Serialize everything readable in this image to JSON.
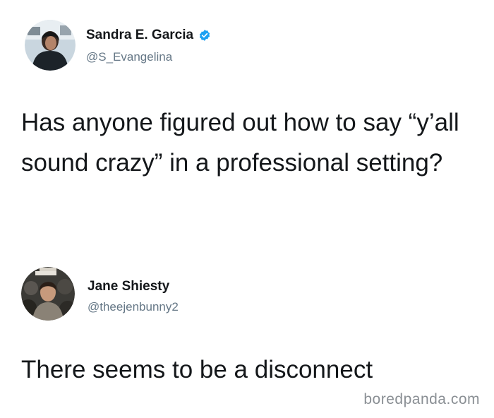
{
  "tweets": [
    {
      "display_name": "Sandra E. Garcia",
      "handle": "@S_Evangelina",
      "verified": true,
      "avatar_icon": "user-avatar-icon",
      "text": "Has anyone figured out how to say “y’all sound crazy” in a professional setting?"
    },
    {
      "display_name": "Jane Shiesty",
      "handle": "@theejenbunny2",
      "verified": false,
      "avatar_icon": "user-avatar-icon",
      "text": "There seems to be a disconnect"
    }
  ],
  "watermark": "boredpanda.com",
  "colors": {
    "text": "#14171a",
    "secondary_text": "#657786",
    "verified_blue": "#1da1f2",
    "watermark": "#8a8f94"
  }
}
